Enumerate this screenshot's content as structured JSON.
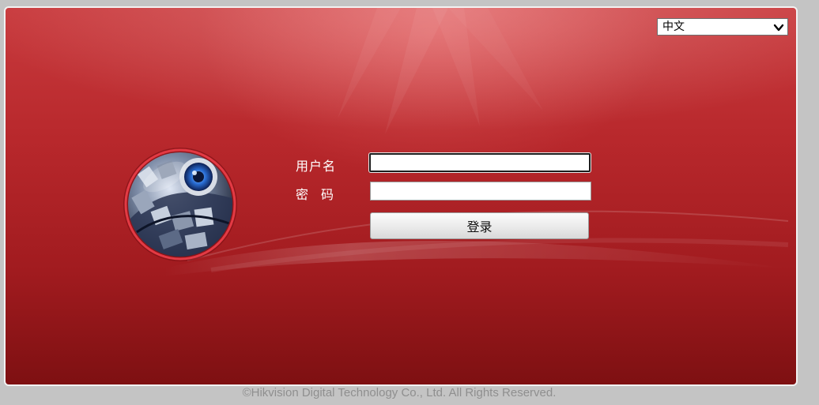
{
  "language_selector": {
    "value": "中文",
    "icon": "chevron-down-icon"
  },
  "login_form": {
    "username_label": "用户名",
    "password_label": "密　码",
    "username_value": "",
    "password_value": "",
    "login_button": "登录"
  },
  "logo": {
    "icon": "camera-globe-logo"
  },
  "footer": {
    "copyright": "©Hikvision Digital Technology Co., Ltd. All Rights Reserved."
  },
  "colors": {
    "panel_red": "#b8282c",
    "panel_dark": "#7e1012",
    "background": "#c4c4c4",
    "footer_text": "#8f8f8f"
  }
}
